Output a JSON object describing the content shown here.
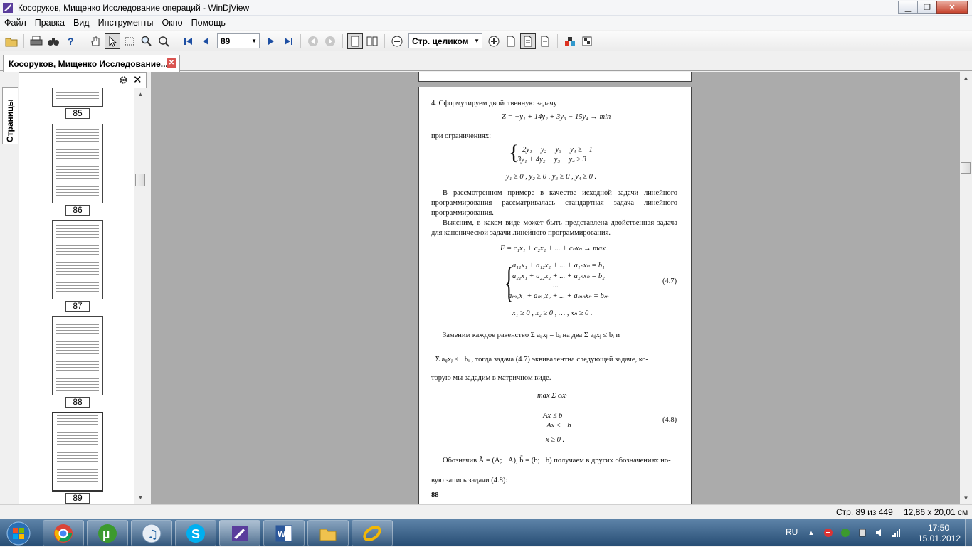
{
  "window": {
    "title": "Косоруков, Мищенко Исследование операций - WinDjView"
  },
  "menu": [
    "Файл",
    "Правка",
    "Вид",
    "Инструменты",
    "Окно",
    "Помощь"
  ],
  "toolbar": {
    "page_value": "89",
    "zoom_value": "Стр. целиком"
  },
  "doc_tab": {
    "label": "Косоруков, Мищенко Исследование..."
  },
  "sidebar": {
    "tab_label": "Страницы",
    "thumbnails": [
      {
        "label": "85"
      },
      {
        "label": "86"
      },
      {
        "label": "87"
      },
      {
        "label": "88"
      },
      {
        "label": "89"
      }
    ]
  },
  "page": {
    "item4": "4.  Сформулируем двойственную задачу",
    "objective": "Z = −y₁ + 14y₂ + 3y₃ − 15y₄ → min",
    "constraints_intro": "при ограничениях:",
    "c1": "−2y₁ − y₂ + y₃ − y₄ ≥ −1",
    "c2": "3y₁ + 4y₂ − y₃ − y₄ ≥ 3",
    "nonneg_y": "y₁ ≥ 0 ,  y₂ ≥ 0 ,  y₃ ≥ 0 ,  y₄ ≥ 0 .",
    "para1": "В рассмотренном примере в качестве исходной задачи линейного программирования рассматривалась стандартная задача линейного программирования.",
    "para2": "Выясним, в каком виде может быть представлена двойственная задача для канонической задачи линейного программирования.",
    "F": "F = c₁x₁ + c₂x₂ + ... + cₙxₙ → max .",
    "s1": "a₁₁x₁ + a₁₂x₂ + ... + a₁ₙxₙ = b₁",
    "s2": "a₂₁x₁ + a₂₂x₂ + ... + a₂ₙxₙ = b₂",
    "s3": "...",
    "s4": "aₘ₁x₁ + aₘ₂x₂ + ... + aₘₙxₙ = bₘ",
    "eq47": "(4.7)",
    "nonneg_x": "x₁ ≥ 0 ,  x₂ ≥ 0 , … ,  xₙ ≥ 0 .",
    "para3a": "Заменим каждое равенство  Σ aᵢⱼxⱼ = bᵢ  на два  Σ aᵢⱼxⱼ ≤ bᵢ  и",
    "para3b": "−Σ aᵢⱼxⱼ ≤ −bᵢ , тогда задача (4.7) эквивалентна следующей задаче, ко-",
    "para3c": "торую мы зададим в матричном виде.",
    "max": "max Σ cᵢxᵢ",
    "m1": "Ax ≤ b",
    "m2": "−Ax ≤ −b",
    "eq48": "(4.8)",
    "m3": "x ≥ 0 .",
    "para4a": "Обозначив  Ã = (A; −A),  b̃ = (b; −b)  получаем в других обозначениях но-",
    "para4b": "вую запись задачи (4.8):",
    "page_number": "88"
  },
  "status": {
    "page_info": "Стр. 89 из 449",
    "page_size": "12,86 x 20,01 см"
  },
  "tray": {
    "lang": "RU",
    "time": "17:50",
    "date": "15.01.2012"
  },
  "colors": {
    "view_bg": "#ababab",
    "taskbar": "#3f6890"
  }
}
